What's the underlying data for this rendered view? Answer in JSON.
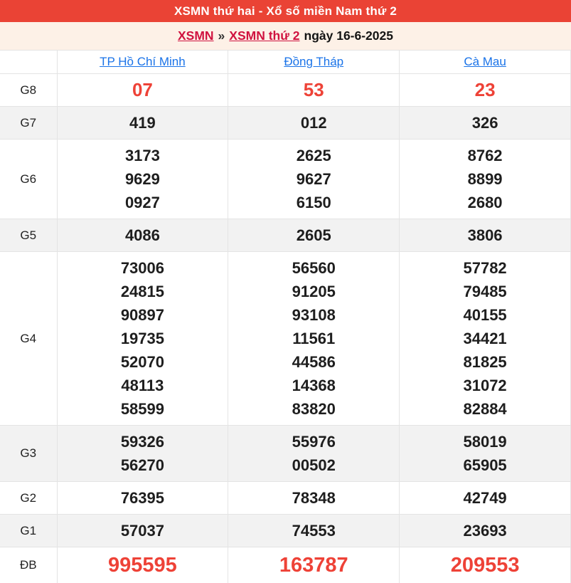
{
  "header": {
    "title": "XSMN thứ hai - Xổ số miền Nam thứ 2"
  },
  "breadcrumb": {
    "link_xsmn": "XSMN",
    "separator": "»",
    "link_day": "XSMN thứ 2",
    "date_text": "ngày 16-6-2025"
  },
  "table": {
    "columns": [
      "TP Hồ Chí Minh",
      "Đồng Tháp",
      "Cà Mau"
    ],
    "rows": [
      {
        "label": "G8",
        "highlight": true,
        "big": false,
        "cells": [
          [
            "07"
          ],
          [
            "53"
          ],
          [
            "23"
          ]
        ]
      },
      {
        "label": "G7",
        "highlight": false,
        "big": false,
        "cells": [
          [
            "419"
          ],
          [
            "012"
          ],
          [
            "326"
          ]
        ]
      },
      {
        "label": "G6",
        "highlight": false,
        "big": false,
        "cells": [
          [
            "3173",
            "9629",
            "0927"
          ],
          [
            "2625",
            "9627",
            "6150"
          ],
          [
            "8762",
            "8899",
            "2680"
          ]
        ]
      },
      {
        "label": "G5",
        "highlight": false,
        "big": false,
        "cells": [
          [
            "4086"
          ],
          [
            "2605"
          ],
          [
            "3806"
          ]
        ]
      },
      {
        "label": "G4",
        "highlight": false,
        "big": false,
        "cells": [
          [
            "73006",
            "24815",
            "90897",
            "19735",
            "52070",
            "48113",
            "58599"
          ],
          [
            "56560",
            "91205",
            "93108",
            "11561",
            "44586",
            "14368",
            "83820"
          ],
          [
            "57782",
            "79485",
            "40155",
            "34421",
            "81825",
            "31072",
            "82884"
          ]
        ]
      },
      {
        "label": "G3",
        "highlight": false,
        "big": false,
        "cells": [
          [
            "59326",
            "56270"
          ],
          [
            "55976",
            "00502"
          ],
          [
            "58019",
            "65905"
          ]
        ]
      },
      {
        "label": "G2",
        "highlight": false,
        "big": false,
        "cells": [
          [
            "76395"
          ],
          [
            "78348"
          ],
          [
            "42749"
          ]
        ]
      },
      {
        "label": "G1",
        "highlight": false,
        "big": false,
        "cells": [
          [
            "57037"
          ],
          [
            "74553"
          ],
          [
            "23693"
          ]
        ]
      },
      {
        "label": "ĐB",
        "highlight": true,
        "big": true,
        "cells": [
          [
            "995595"
          ],
          [
            "163787"
          ],
          [
            "209553"
          ]
        ]
      }
    ]
  },
  "colors": {
    "header_bg": "#ea4335",
    "number_red": "#ee4237",
    "province_link_blue": "#1a73e8",
    "breadcrumb_link_red": "#d0123f",
    "breadcrumb_bg": "#fdf1e7",
    "alt_row_bg": "#f2f2f2"
  }
}
